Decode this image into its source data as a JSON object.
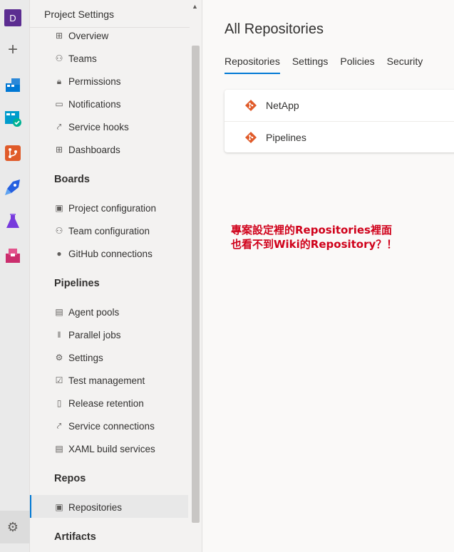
{
  "rail": {
    "avatar_letter": "D",
    "icons": [
      "plus-icon",
      "overview-icon",
      "boards-icon",
      "repos-icon",
      "pipelines-icon",
      "test-plans-icon",
      "artifacts-icon",
      "gear-icon"
    ],
    "colors": {
      "avatar": "#5c2d91",
      "overview": "#0078d4",
      "boards": "#009ccc",
      "repos": "#e05b2a",
      "pipelines": "#2560e0",
      "test_plans": "#773adc",
      "artifacts": "#cb2e6d"
    }
  },
  "nav": {
    "title": "Project Settings",
    "general_items": [
      {
        "label": "Overview",
        "icon": "overview-icon"
      },
      {
        "label": "Teams",
        "icon": "teams-icon"
      },
      {
        "label": "Permissions",
        "icon": "lock-icon"
      },
      {
        "label": "Notifications",
        "icon": "notification-icon"
      },
      {
        "label": "Service hooks",
        "icon": "service-hooks-icon"
      },
      {
        "label": "Dashboards",
        "icon": "dashboards-icon"
      }
    ],
    "boards": {
      "heading": "Boards",
      "items": [
        {
          "label": "Project configuration",
          "icon": "project-config-icon"
        },
        {
          "label": "Team configuration",
          "icon": "team-config-icon"
        },
        {
          "label": "GitHub connections",
          "icon": "github-icon"
        }
      ]
    },
    "pipelines": {
      "heading": "Pipelines",
      "items": [
        {
          "label": "Agent pools",
          "icon": "agent-pools-icon"
        },
        {
          "label": "Parallel jobs",
          "icon": "parallel-jobs-icon"
        },
        {
          "label": "Settings",
          "icon": "settings-gear-icon"
        },
        {
          "label": "Test management",
          "icon": "test-management-icon"
        },
        {
          "label": "Release retention",
          "icon": "release-retention-icon"
        },
        {
          "label": "Service connections",
          "icon": "service-connections-icon"
        },
        {
          "label": "XAML build services",
          "icon": "xaml-build-icon"
        }
      ]
    },
    "repos": {
      "heading": "Repos",
      "items": [
        {
          "label": "Repositories",
          "icon": "repositories-icon",
          "selected": true
        }
      ]
    },
    "artifacts": {
      "heading": "Artifacts"
    }
  },
  "main": {
    "title": "All Repositories",
    "tabs": [
      {
        "label": "Repositories",
        "active": true
      },
      {
        "label": "Settings",
        "active": false
      },
      {
        "label": "Policies",
        "active": false
      },
      {
        "label": "Security",
        "active": false
      }
    ],
    "repositories": [
      {
        "name": "NetApp",
        "icon": "git-repo-icon"
      },
      {
        "name": "Pipelines",
        "icon": "git-repo-icon"
      }
    ],
    "git_icon_color": "#e05b2a",
    "accent_color": "#0078d4"
  },
  "annotation": {
    "line1": "專案設定裡的Repositories裡面",
    "line2": "也看不到Wiki的Repository？！",
    "color": "#d0021b"
  }
}
